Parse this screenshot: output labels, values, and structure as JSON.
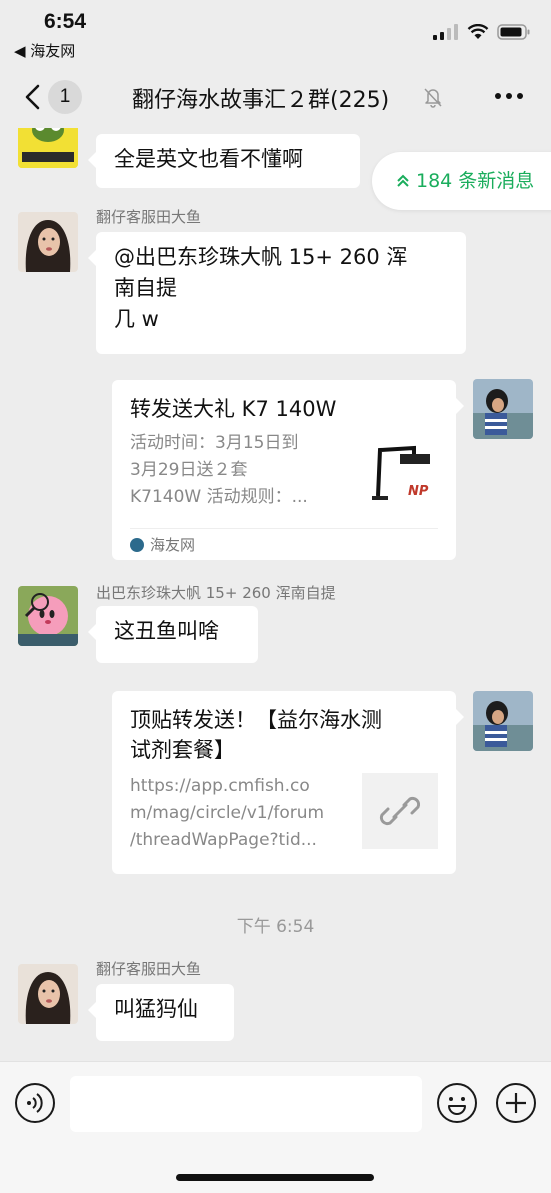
{
  "status_bar": {
    "time": "6:54",
    "back_app": "◀ 海友网"
  },
  "nav": {
    "badge_count": "1",
    "title": "翻仔海水故事汇２群(225)"
  },
  "new_messages": {
    "label": "184 条新消息"
  },
  "messages": [
    {
      "text": "全是英文也看不懂啊"
    },
    {
      "sender": "翻仔客服田大鱼",
      "lines": [
        "@出巴东珍珠大帆 15+  260 浑",
        "南自提",
        "几 w"
      ]
    },
    {
      "card_title": "转发送大礼  K7 140W",
      "card_desc": [
        "活动时间：3月15日到",
        "3月29日送２套",
        "K7140W 活动规则：..."
      ],
      "source": "海友网",
      "thumb_text": "NP"
    },
    {
      "sender": "出巴东珍珠大帆 15+  260 浑南自提",
      "text": "这丑鱼叫啥"
    },
    {
      "card_title_lines": [
        "顶贴转发送！【益尔海水测",
        "试剂套餐】"
      ],
      "card_desc": [
        "https://app.cmfish.co",
        "m/mag/circle/v1/forum",
        "/threadWapPage?tid..."
      ]
    },
    {
      "timestamp": "下午 6:54"
    },
    {
      "sender": "翻仔客服田大鱼",
      "text": "叫猛犸仙"
    }
  ],
  "input": {
    "placeholder": ""
  },
  "colors": {
    "accent_green": "#1aad5c",
    "background": "#ededed",
    "bubble": "#ffffff"
  },
  "icons": [
    "back-chevron-icon",
    "mute-bell-icon",
    "more-dots-icon",
    "voice-icon",
    "emoji-icon",
    "plus-icon",
    "link-icon",
    "signal-icon",
    "wifi-icon",
    "battery-icon"
  ]
}
